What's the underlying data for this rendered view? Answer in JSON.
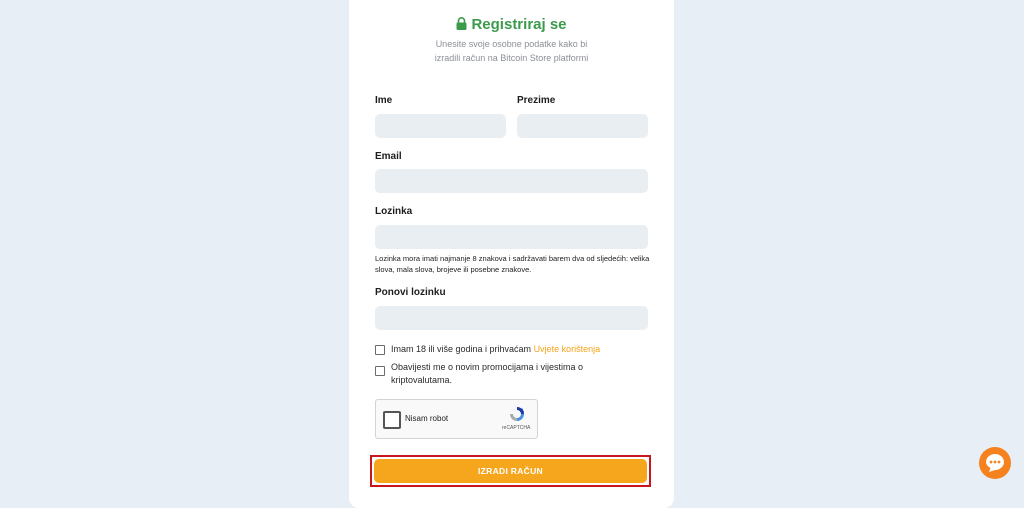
{
  "form": {
    "title": "Registriraj se",
    "subtitle": "Unesite svoje osobne podatke kako bi izradili račun na Bitcoin Store platformi",
    "fields": {
      "first_name": {
        "label": "Ime",
        "value": ""
      },
      "last_name": {
        "label": "Prezime",
        "value": ""
      },
      "email": {
        "label": "Email",
        "value": ""
      },
      "password": {
        "label": "Lozinka",
        "value": ""
      },
      "password_repeat": {
        "label": "Ponovi lozinku",
        "value": ""
      }
    },
    "password_hint": "Lozinka mora imati najmanje 8 znakova i sadržavati barem dva od sljedećih: velika slova, mala slova, brojeve ili posebne znakove.",
    "terms": {
      "text": "Imam 18 ili više godina i prihvaćam ",
      "link": "Uvjete korištenja",
      "checked": false
    },
    "newsletter": {
      "text": "Obavijesti me o novim promocijama i vijestima o kriptovalutama.",
      "checked": false
    },
    "captcha": {
      "label": "Nisam robot",
      "brand": "reCAPTCHA"
    },
    "submit_label": "IZRADI RAČUN"
  },
  "colors": {
    "accent_green": "#3c9a4d",
    "accent_orange": "#f6a61c",
    "highlight_red": "#c8161d",
    "page_bg": "#e7eef5"
  },
  "icons": {
    "title": "lock-icon",
    "chat": "chat-bubble-icon",
    "captcha": "recaptcha-logo-icon"
  }
}
